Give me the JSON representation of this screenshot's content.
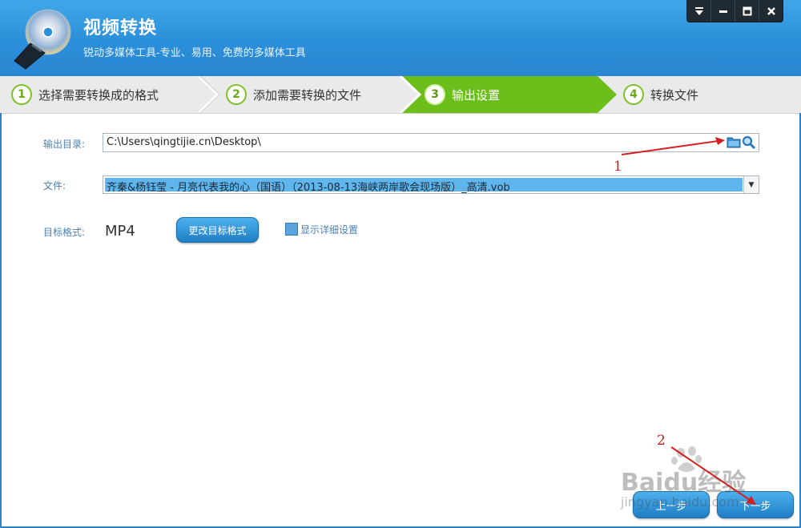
{
  "header": {
    "title": "视频转换",
    "subtitle": "锐动多媒体工具-专业、易用、免费的多媒体工具",
    "window_controls": [
      "menu-icon",
      "minimize-icon",
      "maximize-icon",
      "close-icon"
    ]
  },
  "steps": [
    {
      "num": "1",
      "label": "选择需要转换成的格式",
      "active": false
    },
    {
      "num": "2",
      "label": "添加需要转换的文件",
      "active": false
    },
    {
      "num": "3",
      "label": "输出设置",
      "active": true
    },
    {
      "num": "4",
      "label": "转换文件",
      "active": false
    }
  ],
  "form": {
    "output_dir_label": "输出目录:",
    "output_dir_value": "C:\\Users\\qingtijie.cn\\Desktop\\",
    "file_label": "文件:",
    "file_value": "齐秦&杨钰莹 - 月亮代表我的心（国语）（2013-08-13海峡两岸歌会现场版）_高清.vob",
    "target_format_label": "目标格式:",
    "target_format_value": "MP4",
    "change_format_button": "更改目标格式",
    "show_detail_checkbox": "显示详细设置"
  },
  "footer": {
    "prev_button": "上一步",
    "next_button": "下一步"
  },
  "annotations": {
    "marker_1": "1",
    "marker_2": "2"
  },
  "watermark": {
    "line1": "Baidu经验",
    "line2": "jingyan.baidu.com"
  },
  "colors": {
    "header_blue": "#2c8fd9",
    "active_step_green": "#6cbf1b",
    "annotation_red": "#c12020"
  }
}
